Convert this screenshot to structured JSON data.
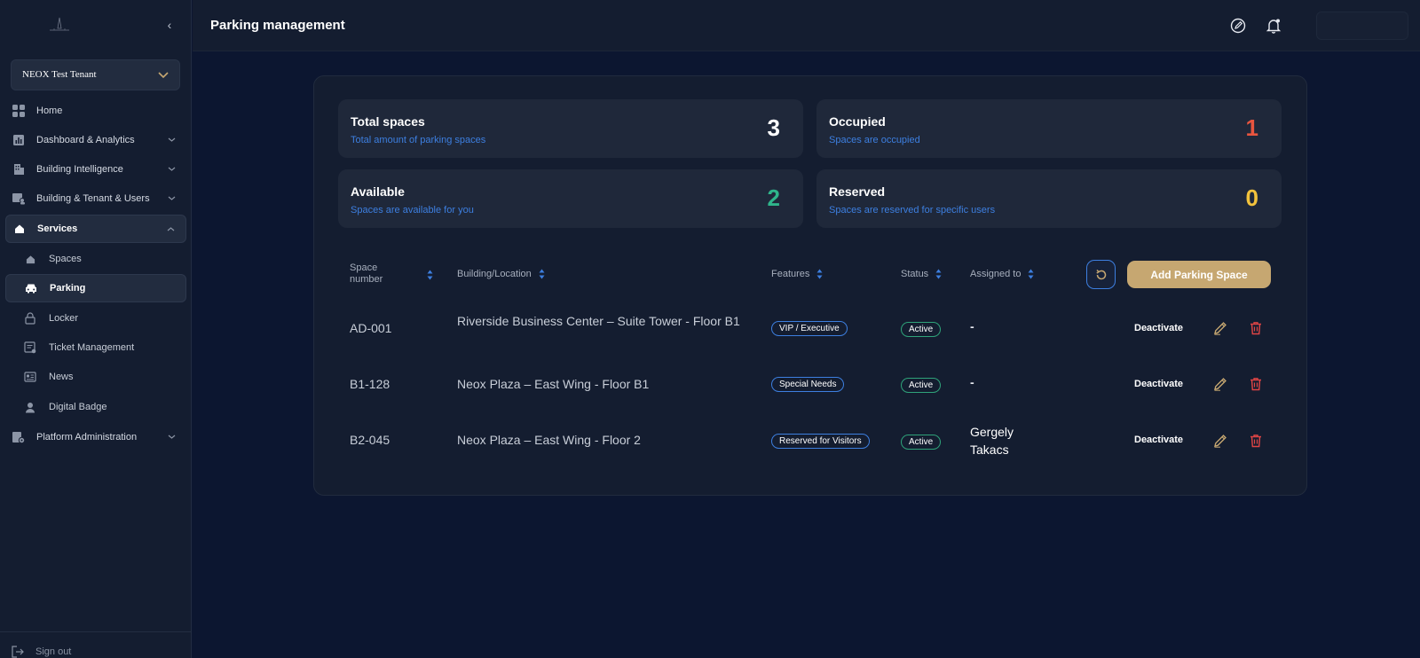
{
  "sidebar": {
    "tenant": "NEOX Test Tenant",
    "items": [
      {
        "label": "Home",
        "icon": "grid-icon"
      },
      {
        "label": "Dashboard & Analytics",
        "icon": "chart-icon"
      },
      {
        "label": "Building Intelligence",
        "icon": "building-icon"
      },
      {
        "label": "Building & Tenant & Users",
        "icon": "users-icon"
      },
      {
        "label": "Services",
        "icon": "home-icon"
      },
      {
        "label": "Platform Administration",
        "icon": "admin-icon"
      }
    ],
    "sub_items": [
      {
        "label": "Spaces",
        "icon": "home-icon"
      },
      {
        "label": "Parking",
        "icon": "car-icon"
      },
      {
        "label": "Locker",
        "icon": "lock-icon"
      },
      {
        "label": "Ticket Management",
        "icon": "ticket-icon"
      },
      {
        "label": "News",
        "icon": "news-icon"
      },
      {
        "label": "Digital Badge",
        "icon": "person-icon"
      }
    ],
    "signout": "Sign out"
  },
  "header": {
    "title": "Parking management"
  },
  "stats": [
    {
      "title": "Total spaces",
      "subtitle": "Total amount of parking spaces",
      "value": "3",
      "color": "#ffffff"
    },
    {
      "title": "Occupied",
      "subtitle": "Spaces are occupied",
      "value": "1",
      "color": "#e8553f"
    },
    {
      "title": "Available",
      "subtitle": "Spaces are available for you",
      "value": "2",
      "color": "#2fb58b"
    },
    {
      "title": "Reserved",
      "subtitle": "Spaces are reserved for specific users",
      "value": "0",
      "color": "#f2c23c"
    }
  ],
  "table": {
    "columns": {
      "space_number": "Space number",
      "building": "Building/Location",
      "features": "Features",
      "status": "Status",
      "assigned": "Assigned to"
    },
    "add_button": "Add Parking Space",
    "rows": [
      {
        "space": "AD-001",
        "building": "Riverside Business Center – Suite Tower - Floor B1",
        "feature": "VIP / Executive",
        "status": "Active",
        "assigned": "-",
        "action": "Deactivate"
      },
      {
        "space": "B1-128",
        "building": "Neox Plaza – East Wing - Floor B1",
        "feature": "Special Needs",
        "status": "Active",
        "assigned": "-",
        "action": "Deactivate"
      },
      {
        "space": "B2-045",
        "building": "Neox Plaza – East Wing - Floor 2",
        "feature": "Reserved for Visitors",
        "status": "Active",
        "assigned": "Gergely Takacs",
        "action": "Deactivate"
      }
    ]
  },
  "colors": {
    "accent_blue": "#3d7fe0",
    "gold": "#c6a771",
    "danger": "#e04545",
    "success": "#2fa37a"
  }
}
